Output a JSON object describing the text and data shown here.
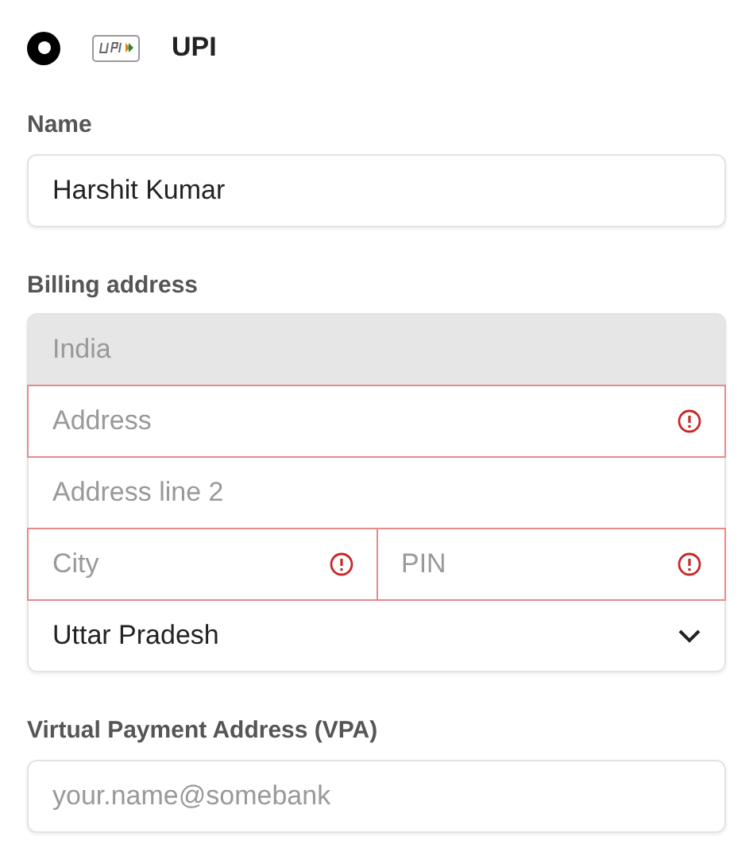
{
  "payment_option": {
    "label": "UPI",
    "selected": true
  },
  "name": {
    "label": "Name",
    "value": "Harshit Kumar"
  },
  "billing_address": {
    "label": "Billing address",
    "fields": [
      {
        "kind": "text",
        "value": "India",
        "disabled": true,
        "invalid": false
      },
      {
        "kind": "text",
        "placeholder": "Address",
        "disabled": false,
        "invalid": true
      },
      {
        "kind": "text",
        "placeholder": "Address line 2",
        "disabled": false,
        "invalid": false
      },
      {
        "kind": "pair",
        "items": [
          {
            "placeholder": "City",
            "invalid": true
          },
          {
            "placeholder": "PIN",
            "invalid": true
          }
        ]
      },
      {
        "kind": "select",
        "value": "Uttar Pradesh",
        "disabled": false,
        "invalid": false
      }
    ]
  },
  "vpa": {
    "label": "Virtual Payment Address (VPA)",
    "placeholder": "your.name@somebank"
  }
}
